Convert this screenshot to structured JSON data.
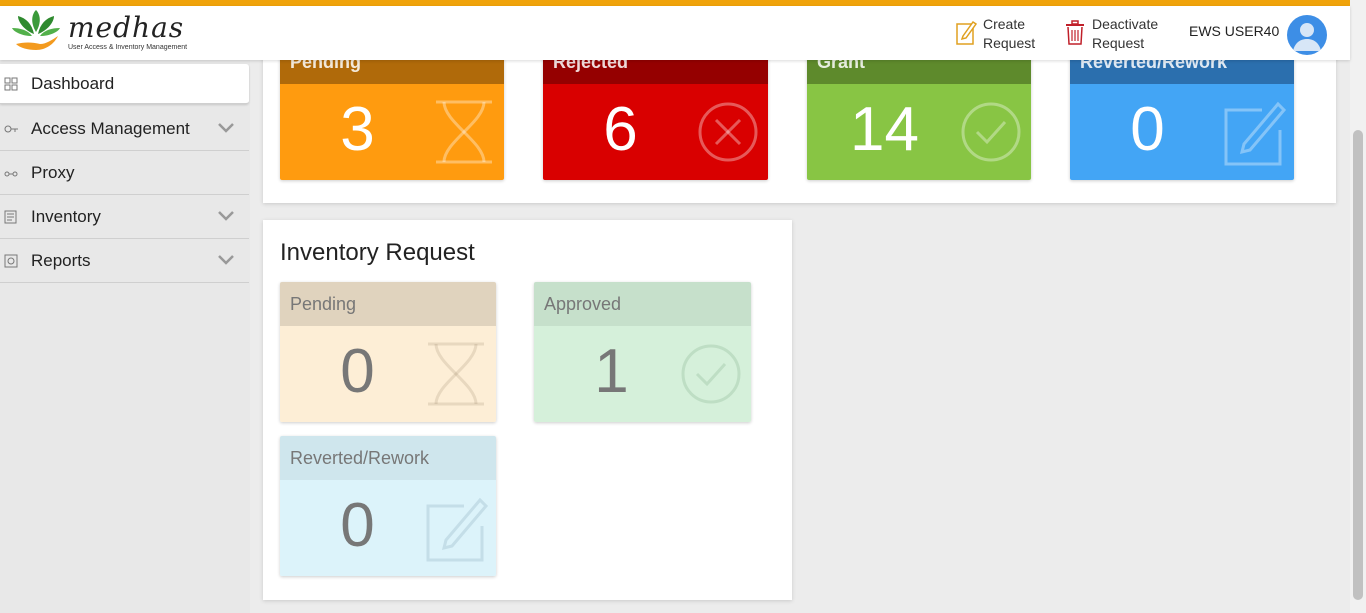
{
  "header": {
    "logo_title": "medhas",
    "logo_subtitle": "User Access & Inventory Management",
    "create_line1": "Create",
    "create_line2": "Request",
    "deactivate_line1": "Deactivate",
    "deactivate_line2": "Request",
    "username": "EWS USER40"
  },
  "sidebar": {
    "items": [
      {
        "label": "Dashboard",
        "icon": "grid-icon"
      },
      {
        "label": "Access Management",
        "icon": "key-icon"
      },
      {
        "label": "Proxy",
        "icon": "proxy-icon"
      },
      {
        "label": "Inventory",
        "icon": "document-icon"
      },
      {
        "label": "Reports",
        "icon": "report-icon"
      }
    ]
  },
  "access_tiles": [
    {
      "label": "Pending",
      "value": "3",
      "icon": "hourglass-icon",
      "head": "#b06a0a",
      "body": "#ff9b0f"
    },
    {
      "label": "Rejected",
      "value": "6",
      "icon": "close-circle-icon",
      "head": "#950000",
      "body": "#d90000"
    },
    {
      "label": "Grant",
      "value": "14",
      "icon": "check-circle-icon",
      "head": "#5e8a2c",
      "body": "#88c544"
    },
    {
      "label": "Reverted/Rework",
      "value": "0",
      "icon": "edit-icon",
      "head": "#2b6fae",
      "body": "#43a5f5"
    }
  ],
  "inventory": {
    "title": "Inventory Request",
    "tiles": [
      {
        "label": "Pending",
        "value": "0",
        "icon": "hourglass-icon",
        "head": "#e0d3be",
        "body": "#fdeed6"
      },
      {
        "label": "Approved",
        "value": "1",
        "icon": "check-circle-icon",
        "head": "#c6e0cb",
        "body": "#d5f0da"
      },
      {
        "label": "Reverted/Rework",
        "value": "0",
        "icon": "edit-icon",
        "head": "#cfe6ed",
        "body": "#dcf3fa"
      }
    ]
  }
}
